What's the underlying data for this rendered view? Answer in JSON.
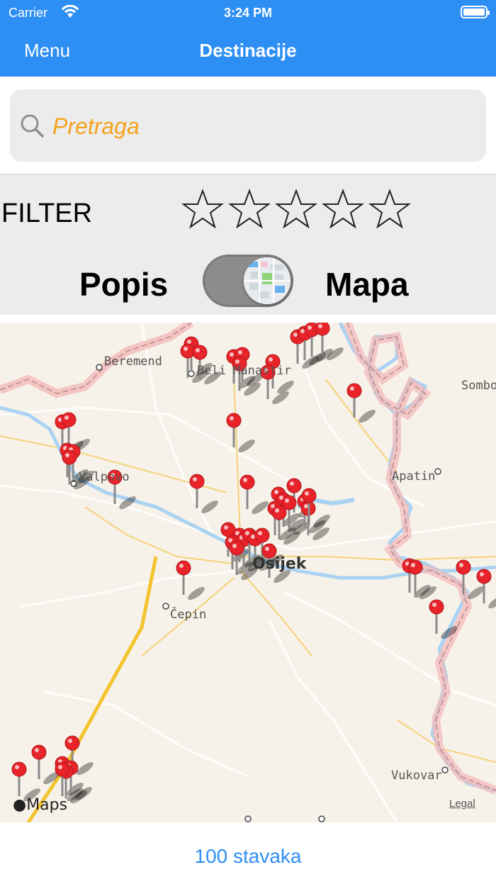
{
  "status_bar": {
    "carrier": "Carrier",
    "time": "3:24 PM"
  },
  "nav": {
    "menu_label": "Menu",
    "title": "Destinacije"
  },
  "search": {
    "placeholder": "Pretraga",
    "value": ""
  },
  "filter": {
    "label": "FILTER",
    "rating": 0,
    "max_stars": 5
  },
  "view_toggle": {
    "left_label": "Popis",
    "right_label": "Mapa",
    "selected": "Mapa"
  },
  "map": {
    "cities": [
      {
        "name": "Beremend"
      },
      {
        "name": "Beli Manastir"
      },
      {
        "name": "Valpovo"
      },
      {
        "name": "Apatin"
      },
      {
        "name": "Osijek"
      },
      {
        "name": "Čepin"
      },
      {
        "name": "Vukovar"
      },
      {
        "name": "Sombor"
      }
    ],
    "logo_text": "Maps",
    "legal_label": "Legal",
    "pin_count_visible": 60
  },
  "footer": {
    "count_text": "100 stavaka"
  },
  "colors": {
    "nav_bar": "#2d8ef3",
    "placeholder": "#f4a21c",
    "pin": "#e8232a",
    "link": "#2d8ef3"
  }
}
